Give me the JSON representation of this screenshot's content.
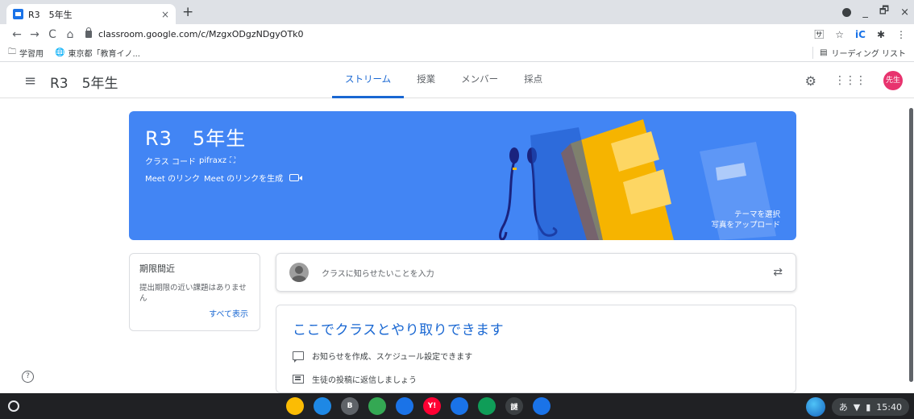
{
  "browser": {
    "tab_title": "R3　5年生",
    "tab_close": "×",
    "new_tab": "+",
    "url": "classroom.google.com/c/MzgxODgzNDgyOTk0",
    "nav": {
      "back": "←",
      "forward": "→",
      "reload": "C",
      "home": "⌂"
    },
    "window_controls": {
      "minimize": "_",
      "restore": "🗗",
      "close": "×"
    },
    "bookmarks": [
      {
        "label": "学習用",
        "icon": "folder-icon"
      },
      {
        "label": "東京都「教育イノ...",
        "icon": "site-icon"
      }
    ],
    "reading_list": "リーディング リスト"
  },
  "header": {
    "class_name": "R3　5年生",
    "tabs": [
      "ストリーム",
      "授業",
      "メンバー",
      "採点"
    ],
    "active_tab": 0,
    "avatar_text": "先生"
  },
  "banner": {
    "title": "R3　5年生",
    "class_code_label": "クラス コード",
    "class_code": "pifraxz",
    "meet_label": "Meet のリンク",
    "meet_generate": "Meet のリンクを生成",
    "theme_select": "テーマを選択",
    "upload_photo": "写真をアップロード",
    "color": "#4285f4"
  },
  "due": {
    "title": "期限間近",
    "text": "提出期限の近い課題はありません",
    "view_all": "すべて表示"
  },
  "post": {
    "placeholder": "クラスに知らせたいことを入力"
  },
  "info": {
    "heading": "ここでクラスとやり取りできます",
    "items": [
      "お知らせを作成、スケジュール設定できます",
      "生徒の投稿に返信しましょう"
    ]
  },
  "shelf": {
    "apps": [
      {
        "name": "chrome",
        "color": "#fbbc04",
        "label": ""
      },
      {
        "name": "app-2",
        "color": "#1e88e5",
        "label": ""
      },
      {
        "name": "app-b",
        "color": "#5f6368",
        "label": "B"
      },
      {
        "name": "play",
        "color": "#34a853",
        "label": ""
      },
      {
        "name": "app-5",
        "color": "#1a73e8",
        "label": ""
      },
      {
        "name": "yahoo",
        "color": "#ff0033",
        "label": "Y!"
      },
      {
        "name": "meet",
        "color": "#1a73e8",
        "label": ""
      },
      {
        "name": "classroom",
        "color": "#0f9d58",
        "label": ""
      },
      {
        "name": "app-9",
        "color": "#3c4043",
        "label": "謎"
      },
      {
        "name": "files",
        "color": "#1a73e8",
        "label": ""
      }
    ],
    "ime": "あ",
    "time": "15:40"
  }
}
